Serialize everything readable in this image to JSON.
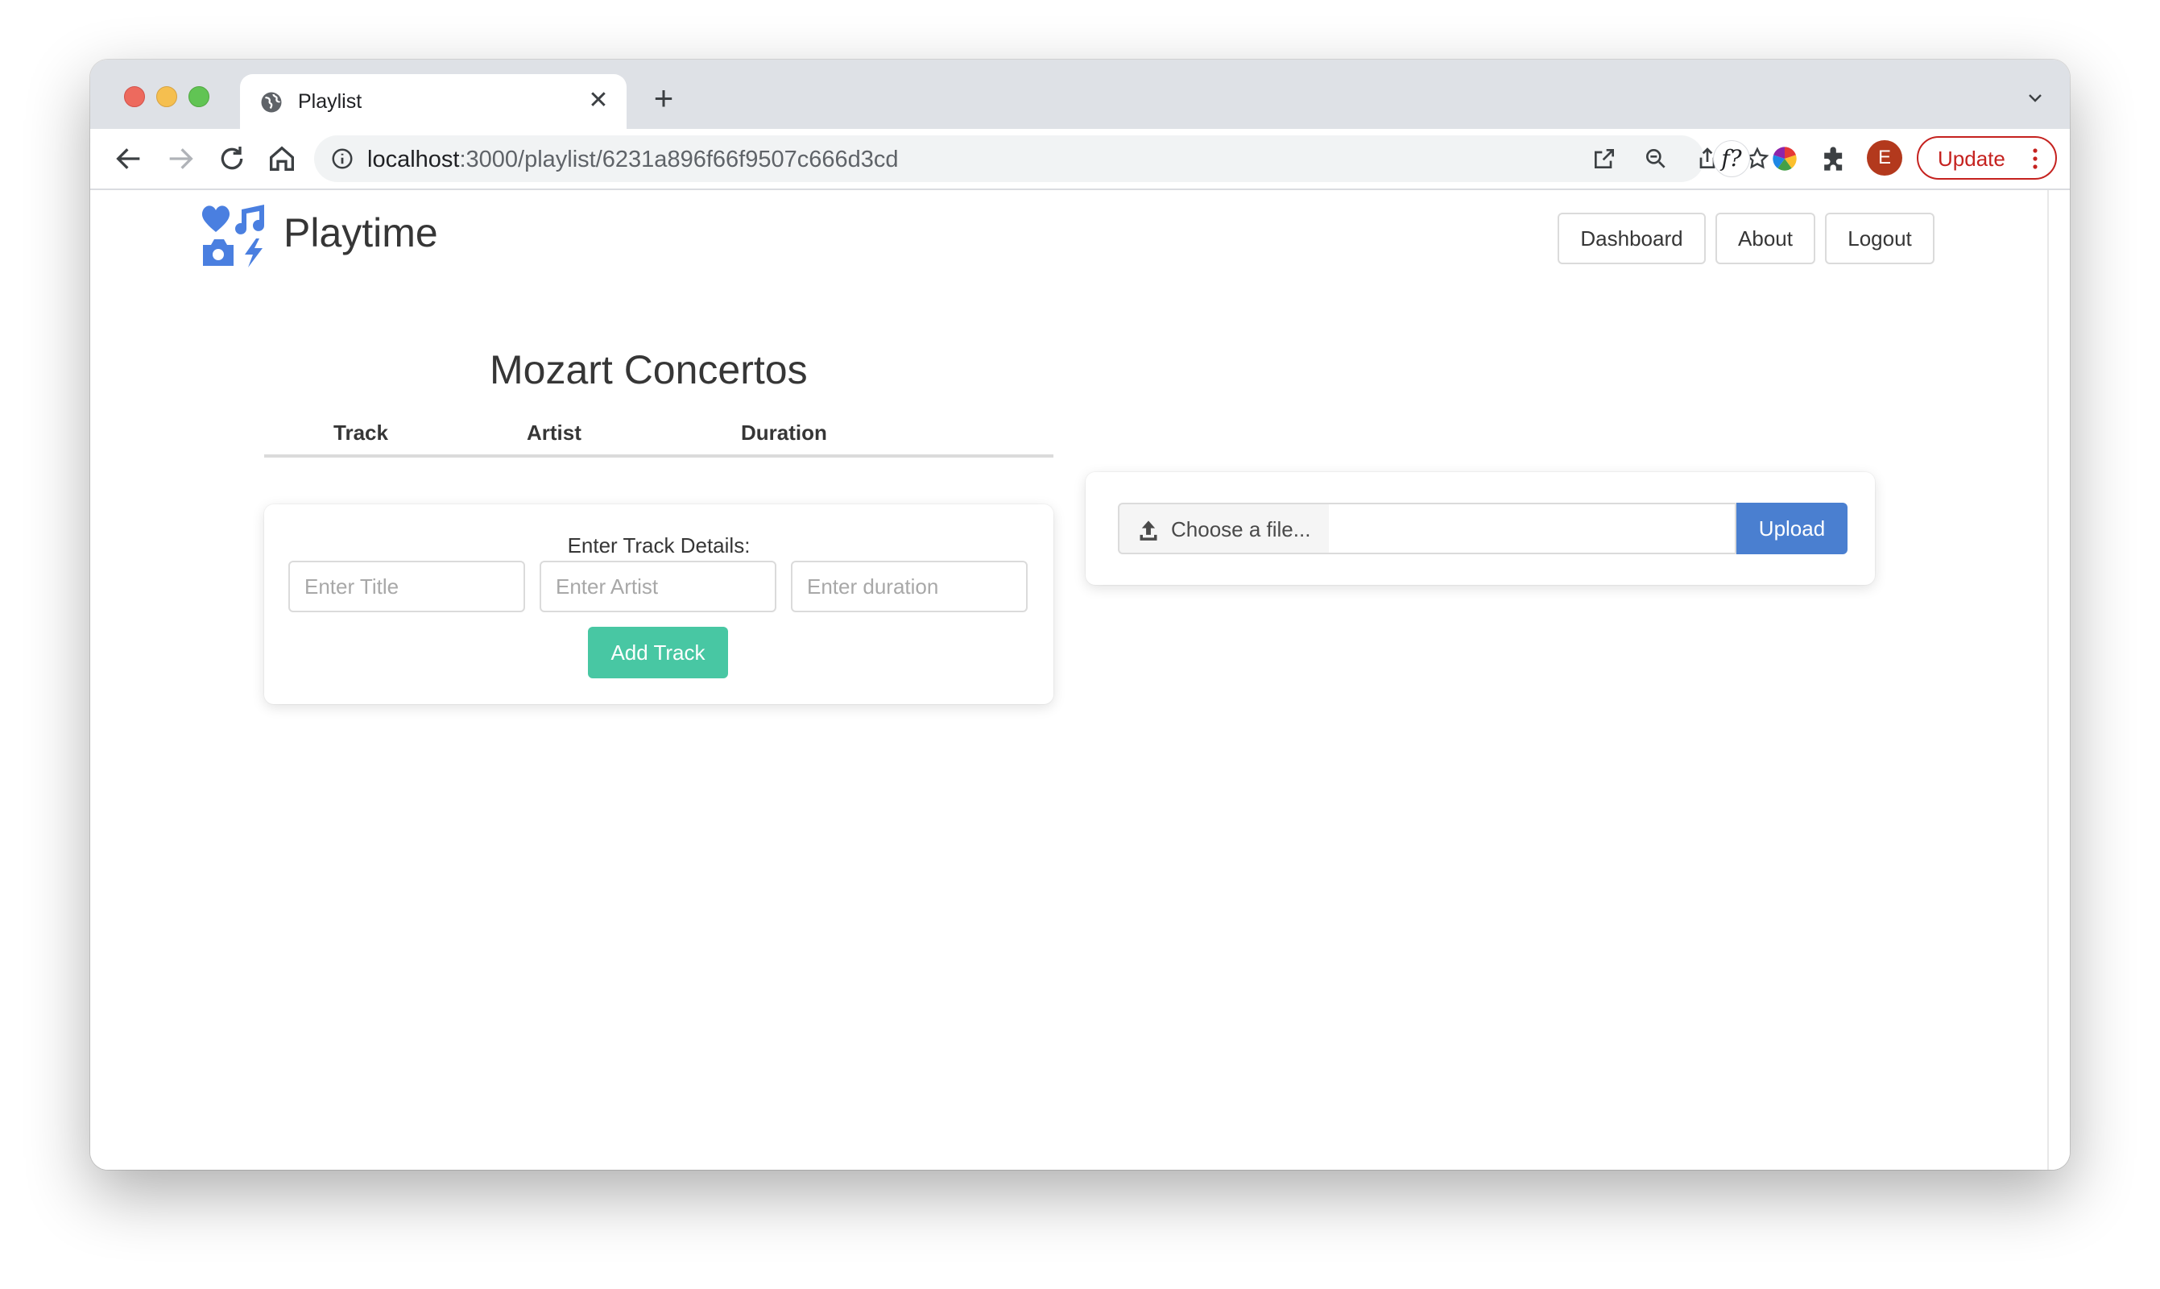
{
  "browser": {
    "tab_title": "Playlist",
    "url_host": "localhost",
    "url_path": ":3000/playlist/6231a896f66f9507c666d3cd",
    "profile_initial": "E",
    "update_label": "Update",
    "ext_font_label": "f?"
  },
  "brand": {
    "name": "Playtime"
  },
  "nav": {
    "dashboard": "Dashboard",
    "about": "About",
    "logout": "Logout"
  },
  "playlist": {
    "title": "Mozart Concertos",
    "columns": [
      "Track",
      "Artist",
      "Duration"
    ]
  },
  "track_form": {
    "label": "Enter Track Details:",
    "title_placeholder": "Enter Title",
    "artist_placeholder": "Enter Artist",
    "duration_placeholder": "Enter duration",
    "submit_label": "Add Track"
  },
  "upload": {
    "choose_label": "Choose a file...",
    "submit_label": "Upload"
  },
  "colors": {
    "add_button": "#48c7a3",
    "upload_button": "#4a7fd0",
    "logo": "#4a7fe0",
    "update_red": "#c5221f"
  }
}
